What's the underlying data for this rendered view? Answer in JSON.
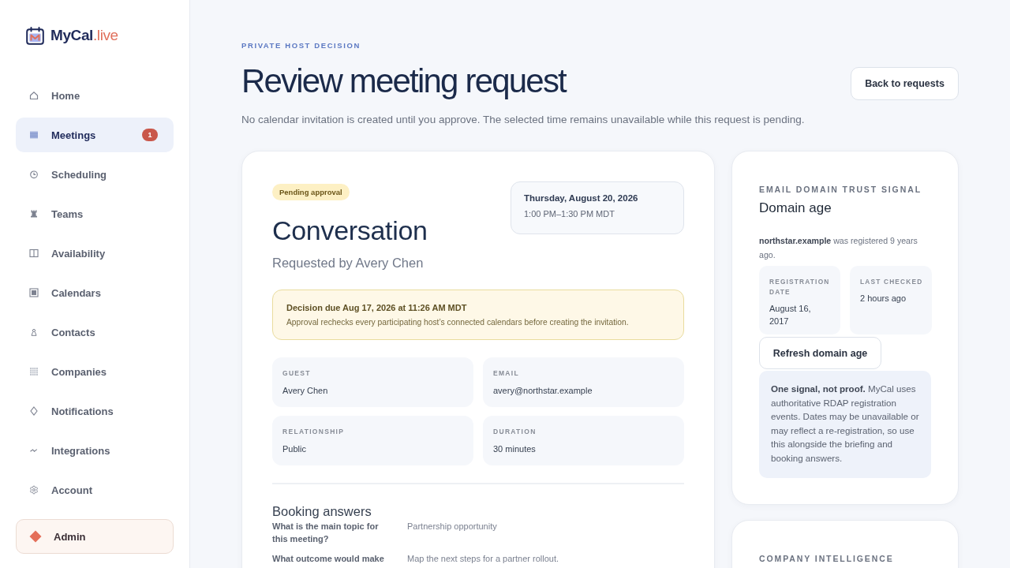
{
  "sidebar": {
    "brand": {
      "name": "MyCal",
      "suffix": ".live"
    },
    "nav": [
      {
        "label": "Home",
        "selected": false
      },
      {
        "label": "Meetings",
        "selected": true,
        "badge": "1"
      },
      {
        "label": "Scheduling",
        "selected": false
      },
      {
        "label": "Teams",
        "selected": false
      },
      {
        "label": "Availability",
        "selected": false
      },
      {
        "label": "Calendars",
        "selected": false
      },
      {
        "label": "Contacts",
        "selected": false
      },
      {
        "label": "Companies",
        "selected": false
      },
      {
        "label": "Notifications",
        "selected": false
      },
      {
        "label": "Integrations",
        "selected": false
      },
      {
        "label": "Account",
        "selected": false
      }
    ],
    "admin": {
      "label": "Admin"
    }
  },
  "header": {
    "eyebrow": "PRIVATE HOST DECISION",
    "title": "Review meeting request",
    "subtitle": "No calendar invitation is created until you approve. The selected time remains unavailable while this request is pending.",
    "back_button": "Back to requests"
  },
  "request": {
    "status": "Pending approval",
    "title": "Conversation",
    "requested_by": "Requested by Avery Chen",
    "slot": {
      "date": "Thursday, August 20, 2026",
      "time": "1:00 PM–1:30 PM MDT"
    },
    "deadline": {
      "title": "Decision due Aug 17, 2026 at 11:26 AM MDT",
      "text": "Approval rechecks every participating host’s connected calendars before creating the invitation."
    },
    "details": [
      {
        "label": "GUEST",
        "value": "Avery Chen"
      },
      {
        "label": "EMAIL",
        "value": "avery@northstar.example"
      },
      {
        "label": "RELATIONSHIP",
        "value": "Public"
      },
      {
        "label": "DURATION",
        "value": "30 minutes"
      }
    ],
    "booking_answers": {
      "title": "Booking answers",
      "items": [
        {
          "question": "What is the main topic for this meeting?",
          "answer": "Partnership opportunity"
        },
        {
          "question": "What outcome would make",
          "answer": "Map the next steps for a partner rollout."
        }
      ]
    }
  },
  "domain_card": {
    "eyebrow": "EMAIL DOMAIN TRUST SIGNAL",
    "title": "Domain age",
    "summary": "**northstar.example** was registered 9 years ago.",
    "facts": [
      {
        "label": "REGISTRATION DATE",
        "value": "August 16, 2017"
      },
      {
        "label": "LAST CHECKED",
        "value": "2 hours ago"
      }
    ],
    "refresh_button": "Refresh domain age",
    "note": "**One signal, not proof.** MyCal uses authoritative RDAP registration events. Dates may be unavailable or may reflect a re-registration, so use this alongside the briefing and booking answers."
  },
  "company_card": {
    "eyebrow": "COMPANY INTELLIGENCE"
  }
}
